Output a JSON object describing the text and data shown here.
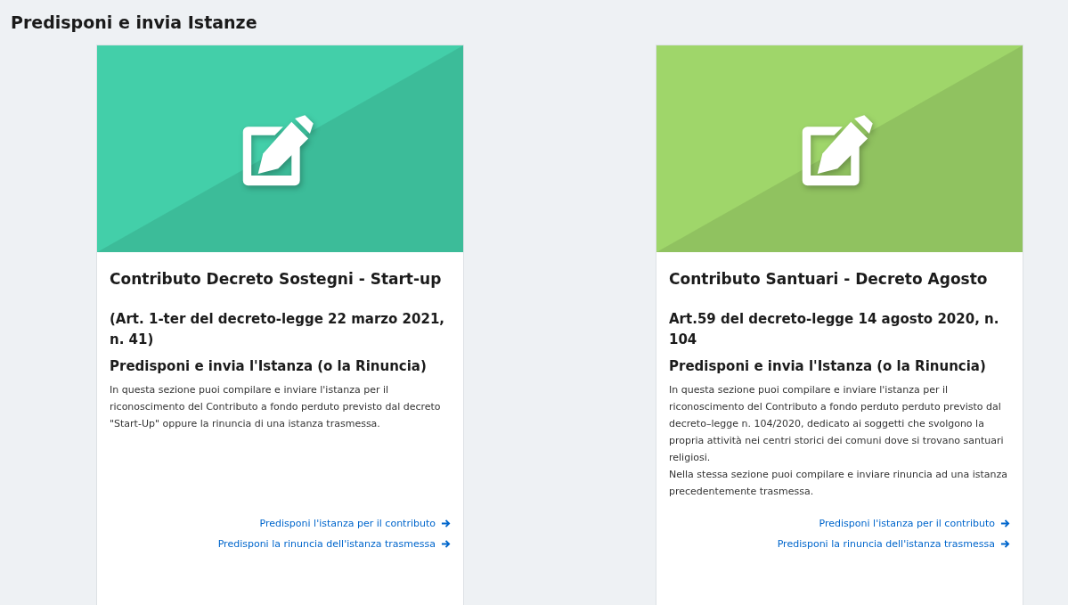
{
  "page_title": "Predisponi e invia Istanze",
  "cards": [
    {
      "color": "#43cfa9",
      "title": "Contributo Decreto Sostegni - Start-up",
      "subtitle": "(Art. 1-ter del decreto-legge 22 marzo 2021, n. 41)",
      "heading": "Predisponi e invia l'Istanza (o la Rinuncia)",
      "description": [
        "In questa sezione puoi compilare e inviare l'istanza per il riconoscimento del Contributo a fondo perduto previsto dal decreto \"Start-Up\" oppure la rinuncia di una istanza trasmessa."
      ],
      "links": [
        "Predisponi l'istanza per il contributo",
        "Predisponi la rinuncia dell'istanza trasmessa"
      ]
    },
    {
      "color": "#9fd66a",
      "title": "Contributo Santuari - Decreto Agosto",
      "subtitle": "Art.59 del decreto-legge 14 agosto 2020, n. 104",
      "heading": "Predisponi e invia l'Istanza (o la Rinuncia)",
      "description": [
        "In questa sezione puoi compilare e inviare l'istanza per il riconoscimento del Contributo a fondo perduto perduto previsto dal decreto–legge n. 104/2020, dedicato ai soggetti che svolgono la propria attività nei centri storici dei comuni dove si trovano santuari religiosi.",
        "Nella stessa sezione puoi compilare e inviare rinuncia ad una istanza precedentemente trasmessa."
      ],
      "links": [
        "Predisponi l'istanza per il contributo",
        "Predisponi la rinuncia dell'istanza trasmessa"
      ]
    }
  ]
}
